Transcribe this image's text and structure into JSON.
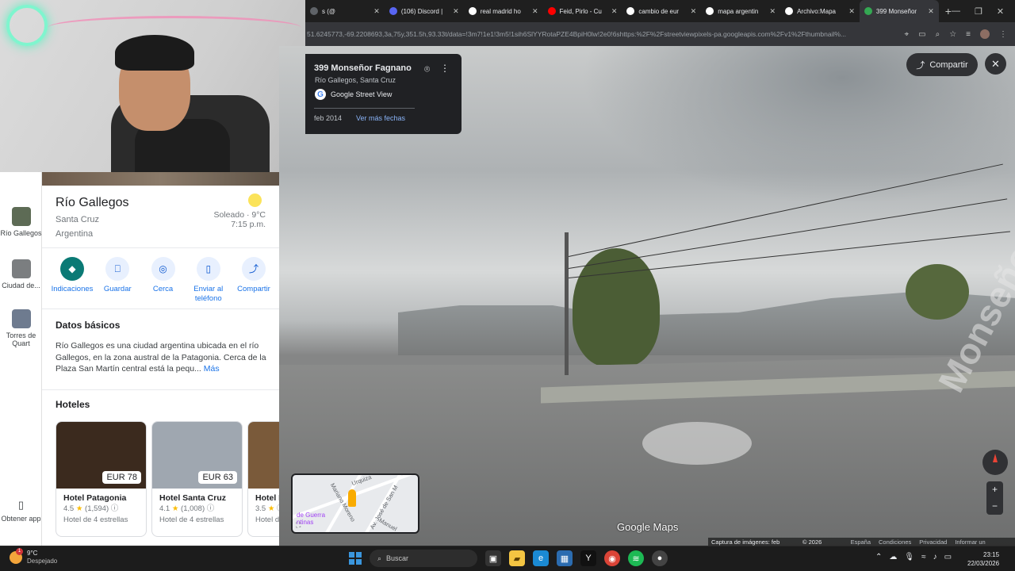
{
  "browser": {
    "tabs": [
      {
        "title": "s (@",
        "color": "#5f6368"
      },
      {
        "title": "(106) Discord |",
        "color": "#5865f2"
      },
      {
        "title": "real madrid ho",
        "color": "#ffffff"
      },
      {
        "title": "Feid, Pirlo - Cu",
        "color": "#ff0000"
      },
      {
        "title": "cambio de eur",
        "color": "#ffffff"
      },
      {
        "title": "mapa argentin",
        "color": "#ffffff"
      },
      {
        "title": "Archivo:Mapa",
        "color": "#ffffff"
      },
      {
        "title": "399 Monseñor",
        "color": "#34a853",
        "active": true
      }
    ],
    "url": "51.6245773,-69.2208693,3a,75y,351.5h,93.33t/data=!3m7!1e1!3m5!1sih6SlYYRotaPZE4BpiH0lw!2e0!6shttps:%2F%2Fstreetviewpixels-pa.googleapis.com%2Fv1%2Fthumbnail%..."
  },
  "rail": {
    "items": [
      {
        "label": "Río Gallegos",
        "color": "#5d6b55"
      },
      {
        "label": "Ciudad de...",
        "color": "#7b7e80"
      },
      {
        "label": "Torres de Quart",
        "color": "#6e7b8f"
      }
    ],
    "get_app": "Obtener app"
  },
  "place": {
    "name": "Río Gallegos",
    "region": "Santa Cruz",
    "country": "Argentina",
    "weather": "Soleado · 9°C",
    "time": "7:15 p.m.",
    "actions": [
      {
        "label": "Indicaciones",
        "icon": "directions-icon"
      },
      {
        "label": "Guardar",
        "icon": "bookmark-icon"
      },
      {
        "label": "Cerca",
        "icon": "nearby-icon"
      },
      {
        "label": "Enviar al teléfono",
        "icon": "phone-icon"
      },
      {
        "label": "Compartir",
        "icon": "share-icon"
      }
    ],
    "basic_title": "Datos básicos",
    "description": "Río Gallegos es una ciudad argentina ubicada en el río Gallegos, en la zona austral de la Patagonia. Cerca de la Plaza San Martín central está la pequ... ",
    "more": "Más",
    "hotels_title": "Hoteles",
    "hotels": [
      {
        "name": "Hotel Patagonia",
        "price": "EUR 78",
        "rating": "4.5",
        "reviews": "(1,594)",
        "class": "Hotel de 4 estrellas",
        "color": "#3b2a1e"
      },
      {
        "name": "Hotel Santa Cruz",
        "price": "EUR 63",
        "rating": "4.1",
        "reviews": "(1,008)",
        "class": "Hotel de 4 estrellas",
        "color": "#9fa7b0"
      },
      {
        "name": "Hotel F",
        "price": "",
        "rating": "3.5",
        "reviews": "",
        "class": "Hotel d",
        "color": "#7a5a3a"
      }
    ]
  },
  "streetview": {
    "address": "399 Monseñor Fagnano",
    "locality": "Río Gallegos, Santa Cruz",
    "source": "Google Street View",
    "date": "feb 2014",
    "more_dates": "Ver más fechas",
    "share": "Compartir",
    "road_label": "Monseñor Fagnano",
    "brand": "Google Maps",
    "footer": [
      "Captura de imágenes: feb 2014",
      "© 2026 Google",
      "España",
      "Condiciones",
      "Privacidad",
      "Informar un problema"
    ]
  },
  "minimap": {
    "labels": [
      "Urquiza",
      "Mariano Moreno",
      "Av. José de San M",
      "Manuel"
    ],
    "poi": "de Guerra\nntinas"
  },
  "taskbar": {
    "temp": "9°C",
    "condition": "Despejado",
    "badge": "1",
    "search": "Buscar",
    "time": "23:15",
    "date": "22/03/2026"
  }
}
